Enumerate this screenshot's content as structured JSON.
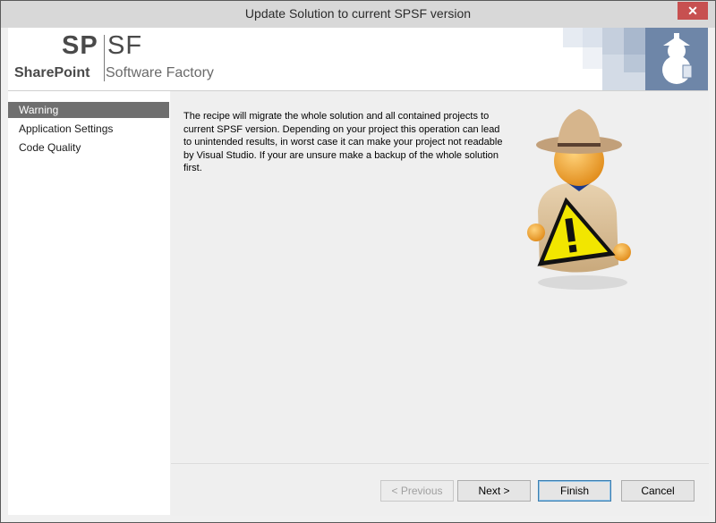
{
  "window": {
    "title": "Update Solution to current SPSF version",
    "close_glyph": "✕"
  },
  "banner": {
    "logo_sp": "SP",
    "logo_sf": "SF",
    "logo_sharepoint": "SharePoint",
    "logo_software_factory": "Software Factory",
    "tile_colors": [
      "#dde3ec",
      "#c5cfdd",
      "#a9b8cd",
      "#8ea1bd"
    ]
  },
  "nav": {
    "items": [
      {
        "label": "Warning",
        "active": true
      },
      {
        "label": "Application Settings",
        "active": false
      },
      {
        "label": "Code Quality",
        "active": false
      }
    ]
  },
  "content": {
    "message": "The recipe will migrate the whole solution and all contained projects to current SPSF version. Depending on your project this operation can lead to unintended results, in worst case it can make your project not readable by Visual Studio. If your are unsure make a backup of the whole solution first.",
    "illustration_icon": "warning-ranger-icon"
  },
  "footer": {
    "previous_label": "< Previous",
    "next_label": "Next >",
    "finish_label": "Finish",
    "cancel_label": "Cancel"
  },
  "colors": {
    "accent": "#3c7fb1",
    "nav_active": "#6f6f6f",
    "close": "#c75050",
    "warning_yellow": "#f2e600"
  }
}
